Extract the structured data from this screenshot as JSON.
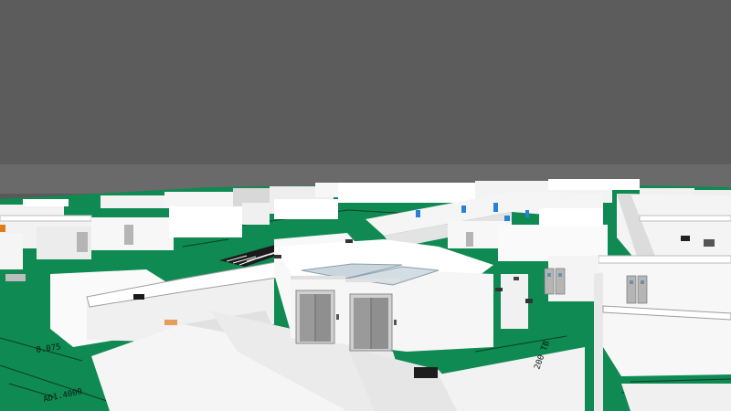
{
  "viewport": {
    "colors": {
      "sky": "#5c5c5c",
      "horizon_band": "#6a6a6a",
      "floor_plan": "#0f8a52",
      "floor_lines": "#0a3d26",
      "wall_top": "#ffffff",
      "wall_face": "#f2f2f2",
      "wall_shadow": "#bdbdbd",
      "window_blue": "#2a7fd6",
      "glass": "#c9d6de",
      "elevator_door": "#9a9a9a",
      "door_grey": "#b5b5b5"
    },
    "objects": {
      "elevators": [
        "elevator-left",
        "elevator-right"
      ],
      "double_doors": [
        "double-door-center",
        "double-door-right"
      ]
    },
    "floor_plan_labels": {
      "label_a": "0.075",
      "label_b": "AD1.4000",
      "label_c": "200 TB"
    }
  }
}
